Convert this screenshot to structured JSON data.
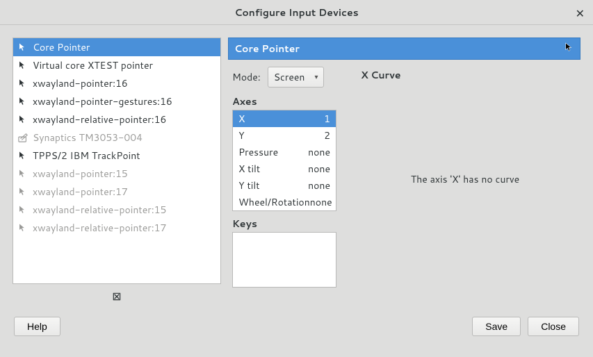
{
  "window": {
    "title": "Configure Input Devices"
  },
  "devices": [
    {
      "label": "Core Pointer",
      "icon": "cursor",
      "selected": true,
      "disabled": false
    },
    {
      "label": "Virtual core XTEST pointer",
      "icon": "cursor",
      "selected": false,
      "disabled": false
    },
    {
      "label": "xwayland-pointer:16",
      "icon": "cursor",
      "selected": false,
      "disabled": false
    },
    {
      "label": "xwayland-pointer-gestures:16",
      "icon": "cursor",
      "selected": false,
      "disabled": false
    },
    {
      "label": "xwayland-relative-pointer:16",
      "icon": "cursor",
      "selected": false,
      "disabled": false
    },
    {
      "label": "Synaptics TM3053-004",
      "icon": "tablet",
      "selected": false,
      "disabled": true
    },
    {
      "label": "TPPS/2 IBM TrackPoint",
      "icon": "cursor",
      "selected": false,
      "disabled": false
    },
    {
      "label": "xwayland-pointer:15",
      "icon": "cursor",
      "selected": false,
      "disabled": true
    },
    {
      "label": "xwayland-pointer:17",
      "icon": "cursor",
      "selected": false,
      "disabled": true
    },
    {
      "label": "xwayland-relative-pointer:15",
      "icon": "cursor",
      "selected": false,
      "disabled": true
    },
    {
      "label": "xwayland-relative-pointer:17",
      "icon": "cursor",
      "selected": false,
      "disabled": true
    }
  ],
  "selection_indicator": "⊠",
  "detail": {
    "title": "Core Pointer",
    "mode_label": "Mode:",
    "mode_value": "Screen",
    "axes_label": "Axes",
    "axes": [
      {
        "name": "X",
        "value": "1",
        "selected": true
      },
      {
        "name": "Y",
        "value": "2",
        "selected": false
      },
      {
        "name": "Pressure",
        "value": "none",
        "selected": false
      },
      {
        "name": "X tilt",
        "value": "none",
        "selected": false
      },
      {
        "name": "Y tilt",
        "value": "none",
        "selected": false
      },
      {
        "name": "Wheel/Rotation",
        "value": "none",
        "selected": false
      }
    ],
    "keys_label": "Keys",
    "curve_title": "X Curve",
    "curve_message": "The axis 'X' has no curve"
  },
  "buttons": {
    "help": "Help",
    "save": "Save",
    "close": "Close"
  }
}
